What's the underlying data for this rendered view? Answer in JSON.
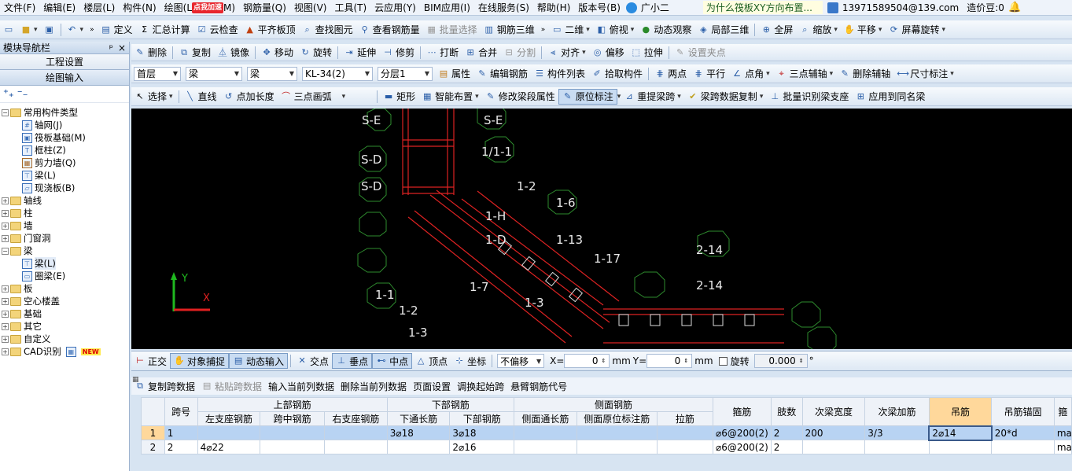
{
  "menu": {
    "items": [
      "文件(F)",
      "编辑(E)",
      "楼层(L)",
      "构件(N)",
      "绘图(L",
      "M)",
      "钢筋量(Q)",
      "视图(V)",
      "工具(T)",
      "云应用(Y)",
      "BIM应用(I)",
      "在线服务(S)",
      "帮助(H)",
      "版本号(B)",
      "广小二"
    ],
    "badge": "点我加速",
    "question": "为什么筏板XY方向布置...",
    "account": "13971589504@139.com",
    "coins": "造价豆:0"
  },
  "toolbar1": {
    "items": [
      "定义",
      "汇总计算",
      "云检查",
      "平齐板顶",
      "查找图元",
      "查看钢筋量",
      "批量选择",
      "钢筋三维"
    ],
    "view_items": [
      "二维",
      "俯视",
      "动态观察",
      "局部三维",
      "全屏",
      "缩放",
      "平移",
      "屏幕旋转"
    ]
  },
  "nav": {
    "title": "模块导航栏",
    "pin": "ᵖ",
    "close": "×",
    "tab1": "工程设置",
    "tab2": "绘图输入",
    "tree": {
      "common": "常用构件类型",
      "common_children": [
        "轴网(J)",
        "筏板基础(M)",
        "框柱(Z)",
        "剪力墙(Q)",
        "梁(L)",
        "现浇板(B)"
      ],
      "groups": [
        "轴线",
        "柱",
        "墙",
        "门窗洞",
        "梁"
      ],
      "beam_children": [
        "梁(L)",
        "圈梁(E)"
      ],
      "groups2": [
        "板",
        "空心楼盖",
        "基础",
        "其它",
        "自定义",
        "CAD识别"
      ],
      "new_badge": "NEW"
    }
  },
  "toolbar2": {
    "items": [
      "删除",
      "复制",
      "镜像",
      "移动",
      "旋转",
      "延伸",
      "修剪",
      "打断",
      "合并",
      "分割",
      "对齐",
      "偏移",
      "拉伸",
      "设置夹点"
    ]
  },
  "toolbar3": {
    "floor": "首层",
    "type1": "梁",
    "type2": "梁",
    "component": "KL-34(2)",
    "layer": "分层1",
    "items": [
      "属性",
      "编辑钢筋",
      "构件列表",
      "拾取构件",
      "两点",
      "平行",
      "点角",
      "三点辅轴",
      "删除辅轴",
      "尺寸标注"
    ]
  },
  "toolbar4": {
    "items": [
      "选择",
      "直线",
      "点加长度",
      "三点画弧",
      "矩形",
      "智能布置",
      "修改梁段属性",
      "原位标注",
      "重提梁跨",
      "梁跨数据复制",
      "批量识别梁支座",
      "应用到同名梁"
    ]
  },
  "canvas": {
    "labels": [
      "S-E",
      "S-E",
      "S-D",
      "1/1-1",
      "S-D",
      "1-2",
      "1-6",
      "1-H",
      "1-D",
      "1-13",
      "2-14",
      "1-17",
      "2-14",
      "1-1",
      "1-2",
      "1-7",
      "1-3",
      "1-3"
    ],
    "axis_y": "Y",
    "axis_x": "X"
  },
  "snapbar": {
    "items": [
      "正交",
      "对象捕捉",
      "动态输入",
      "交点",
      "垂点",
      "中点",
      "顶点",
      "坐标"
    ],
    "offset": "不偏移",
    "x_label": "X=",
    "x_value": "0",
    "mm1": "mm",
    "y_label": "Y=",
    "y_value": "0",
    "mm2": "mm",
    "rotate_label": "旋转",
    "rotate_value": "0.000",
    "degree": "°"
  },
  "table_toolbar": {
    "items": [
      "复制跨数据",
      "粘贴跨数据",
      "输入当前列数据",
      "删除当前列数据",
      "页面设置",
      "调换起始跨",
      "悬臂钢筋代号"
    ]
  },
  "table": {
    "group_headers": [
      "跨号",
      "上部钢筋",
      "下部钢筋",
      "侧面钢筋",
      "箍筋",
      "肢数",
      "次梁宽度",
      "次梁加筋",
      "吊筋",
      "吊筋锚固",
      "箍"
    ],
    "sub_headers": [
      "左支座钢筋",
      "跨中钢筋",
      "右支座钢筋",
      "下通长筋",
      "下部钢筋",
      "侧面通长筋",
      "侧面原位标注筋",
      "拉筋"
    ],
    "rows": [
      {
        "idx": "1",
        "span": "1",
        "left": "",
        "mid": "",
        "right": "",
        "bot_cont": "3⌀18",
        "bot": "3⌀18",
        "side_cont": "",
        "side_orig": "",
        "tie": "",
        "stirrup": "⌀6@200(2)",
        "legs": "2",
        "sub_w": "200",
        "sub_add": "3/3",
        "hanger": "2⌀14",
        "anchor": "20*d",
        "extra": "ma"
      },
      {
        "idx": "2",
        "span": "2",
        "left": "4⌀22",
        "mid": "",
        "right": "",
        "bot_cont": "",
        "bot": "2⌀16",
        "side_cont": "",
        "side_orig": "",
        "tie": "",
        "stirrup": "⌀6@200(2)",
        "legs": "2",
        "sub_w": "",
        "sub_add": "",
        "hanger": "",
        "anchor": "",
        "extra": "ma"
      }
    ]
  }
}
